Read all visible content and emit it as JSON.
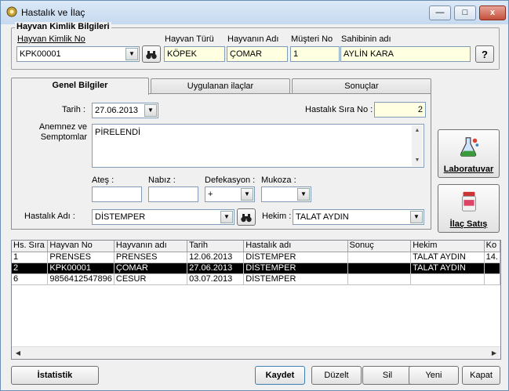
{
  "window": {
    "title": "Hastalık ve İlaç",
    "min_label": "—",
    "max_label": "□",
    "close_label": "x"
  },
  "animal": {
    "group_title": "Hayvan Kimlik Bilgileri",
    "id_label": "Hayvan Kimlik No",
    "id_value": "KPK00001",
    "type_label": "Hayvan Türü",
    "type_value": "KÖPEK",
    "name_label": "Hayvanın Adı",
    "name_value": "ÇOMAR",
    "customer_label": "Müşteri No",
    "customer_value": "1",
    "owner_label": "Sahibinin adı",
    "owner_value": "AYLİN KARA",
    "help_label": "?"
  },
  "tabs": [
    {
      "label": "Genel Bilgiler",
      "active": true
    },
    {
      "label": "Uygulanan ilaçlar",
      "active": false
    },
    {
      "label": "Sonuçlar",
      "active": false
    }
  ],
  "general": {
    "date_label": "Tarih :",
    "date_value": "27.06.2013",
    "seq_label": "Hastalık Sıra No :",
    "seq_value": "2",
    "anamnesis_label": "Anemnez ve Semptomlar",
    "anamnesis_value": "PİRELENDİ",
    "fever_label": "Ateş :",
    "fever_value": "",
    "pulse_label": "Nabız :",
    "pulse_value": "",
    "defecation_label": "Defekasyon :",
    "defecation_value": "+",
    "mucosa_label": "Mukoza :",
    "mucosa_value": "",
    "disease_label": "Hastalık Adı :",
    "disease_value": "DİSTEMPER",
    "vet_label": "Hekim :",
    "vet_value": "TALAT AYDIN"
  },
  "side": {
    "lab_label": "Laboratuvar",
    "pharmacy_label": "İlaç Satış"
  },
  "grid": {
    "columns": [
      "Hs. Sıra",
      "Hayvan No",
      "Hayvanın adı",
      "Tarih",
      "Hastalık adı",
      "Sonuç",
      "Hekim",
      "Ko"
    ],
    "rows": [
      [
        "1",
        "PRENSES",
        "PRENSES",
        "12.06.2013",
        "DİSTEMPER",
        "",
        "TALAT AYDIN",
        "14."
      ],
      [
        "2",
        "KPK00001",
        "ÇOMAR",
        "27.06.2013",
        "DİSTEMPER",
        "",
        "TALAT AYDIN",
        ""
      ],
      [
        "6",
        "9856412547896",
        "CESUR",
        "03.07.2013",
        "DİSTEMPER",
        "",
        "",
        ""
      ]
    ],
    "selected_row": 1
  },
  "footer": {
    "stats_label": "İstatistik",
    "save_label": "Kaydet",
    "edit_label": "Düzelt",
    "delete_label": "Sil",
    "new_label": "Yeni",
    "close_label": "Kapat"
  },
  "colors": {
    "field_yellow": "#ffffe1",
    "selection": "#000000"
  },
  "icons": [
    "app-icon",
    "binoculars-icon",
    "lab-flask-icon",
    "pill-bottle-icon"
  ]
}
